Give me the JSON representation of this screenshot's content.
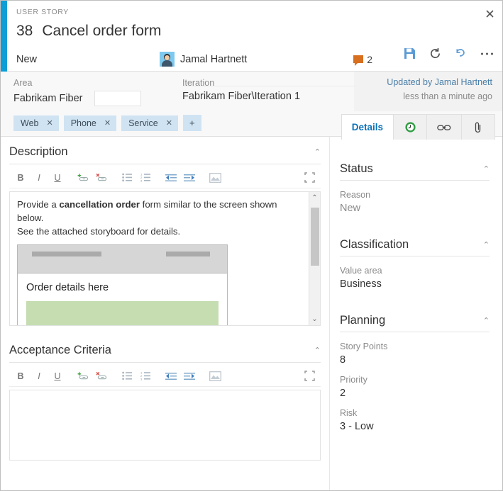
{
  "window": {
    "close_label": "✕",
    "accent_color": "#0c9ed6"
  },
  "header": {
    "work_item_type": "USER STORY",
    "work_item_id": "38",
    "title": "Cancel order form",
    "state": "New",
    "assignee": "Jamal Hartnett",
    "comment_count": "2",
    "actions": [
      {
        "name": "save-icon",
        "label": "Save"
      },
      {
        "name": "refresh-icon",
        "label": "Refresh"
      },
      {
        "name": "undo-icon",
        "label": "Undo"
      },
      {
        "name": "more-options-icon",
        "label": "More"
      }
    ]
  },
  "classification": {
    "area_label": "Area",
    "area_value": "Fabrikam Fiber",
    "iteration_label": "Iteration",
    "iteration_value": "Fabrikam Fiber\\Iteration 1",
    "updated_by": "Updated by Jamal Hartnett",
    "updated_when": "less than a minute ago",
    "tags": [
      "Web",
      "Phone",
      "Service"
    ],
    "tag_remove": "✕",
    "tag_add": "+"
  },
  "tabs": [
    {
      "label": "Details",
      "icon": "",
      "active": true
    },
    {
      "label": "",
      "icon": "history-icon",
      "active": false
    },
    {
      "label": "",
      "icon": "link-icon",
      "active": false
    },
    {
      "label": "",
      "icon": "attachment-icon",
      "active": false
    }
  ],
  "editor_toolbar": [
    {
      "name": "bold-icon",
      "glyph": "B"
    },
    {
      "name": "italic-icon",
      "glyph": "I"
    },
    {
      "name": "underline-icon",
      "glyph": "U"
    },
    {
      "name": "insert-link-icon",
      "glyph": ""
    },
    {
      "name": "remove-link-icon",
      "glyph": ""
    },
    {
      "name": "bullet-list-icon",
      "glyph": ""
    },
    {
      "name": "numbered-list-icon",
      "glyph": ""
    },
    {
      "name": "outdent-icon",
      "glyph": ""
    },
    {
      "name": "indent-icon",
      "glyph": ""
    },
    {
      "name": "insert-image-icon",
      "glyph": ""
    },
    {
      "name": "expand-icon",
      "glyph": ""
    }
  ],
  "description": {
    "title": "Description",
    "collapse": "⌃",
    "text_before_bold": "Provide a ",
    "text_bold": "cancellation order",
    "text_after_bold": " form similar to the screen shown below.",
    "text_line2": "See the attached storyboard for details.",
    "mockup_heading": "Order details here"
  },
  "acceptance_criteria": {
    "title": "Acceptance Criteria",
    "collapse": "⌃",
    "text": ""
  },
  "right_panel": {
    "status": {
      "title": "Status",
      "collapse": "⌃",
      "reason_label": "Reason",
      "reason_value": "New"
    },
    "classification": {
      "title": "Classification",
      "collapse": "⌃",
      "value_area_label": "Value area",
      "value_area_value": "Business"
    },
    "planning": {
      "title": "Planning",
      "collapse": "⌃",
      "story_points_label": "Story Points",
      "story_points_value": "8",
      "priority_label": "Priority",
      "priority_value": "2",
      "risk_label": "Risk",
      "risk_value": "3 - Low"
    }
  },
  "scrollbar": {
    "up": "⌃",
    "down": "⌄"
  }
}
